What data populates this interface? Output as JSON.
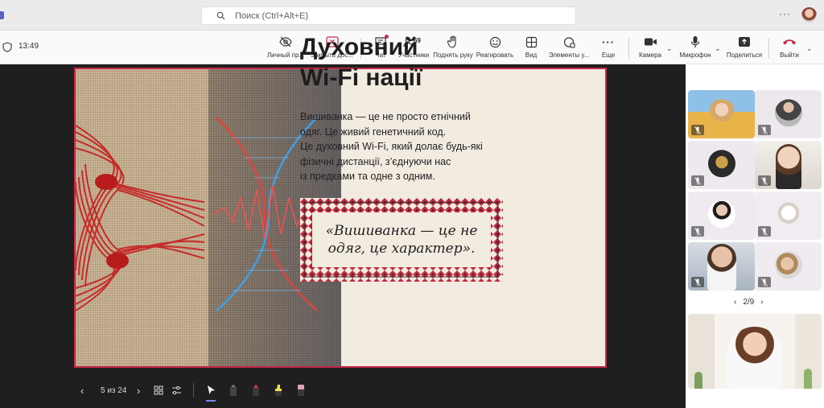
{
  "search": {
    "placeholder": "Поиск (Ctrl+Alt+E)"
  },
  "meeting": {
    "elapsed": "13:49"
  },
  "toolbar": {
    "private_view": "Личный пр...",
    "close_content": "Закрыть дос...",
    "chat": "Чат",
    "participants": "Участники",
    "participants_count": "69",
    "raise_hand": "Поднять руку",
    "react": "Реагировать",
    "view": "Вид",
    "apps": "Элементы у...",
    "more": "Еще",
    "camera": "Камера",
    "mic": "Микрофон",
    "share": "Поделиться",
    "leave": "Выйти"
  },
  "slide": {
    "title_line1": "Духовний",
    "title_line2": "Wi-Fi нації",
    "body": [
      "Вишиванка — це не просто етнічний",
      "одяг. Це живий генетичний код.",
      "Це духовний Wi-Fi, який долає будь-які",
      "фізичні дистанції, з’єднуючи нас",
      "із предками та одне з одним."
    ],
    "quote_line1": "«Вишиванка — це не",
    "quote_line2": "одяг, це характер»."
  },
  "presenter": {
    "page_indicator": "5 из 24"
  },
  "gallery": {
    "page": "2/9"
  },
  "colors": {
    "accent": "#5b5fc7",
    "leave": "#c4314b",
    "embroidery_red": "#c0283c",
    "embroidery_dark": "#2b2b2b"
  }
}
